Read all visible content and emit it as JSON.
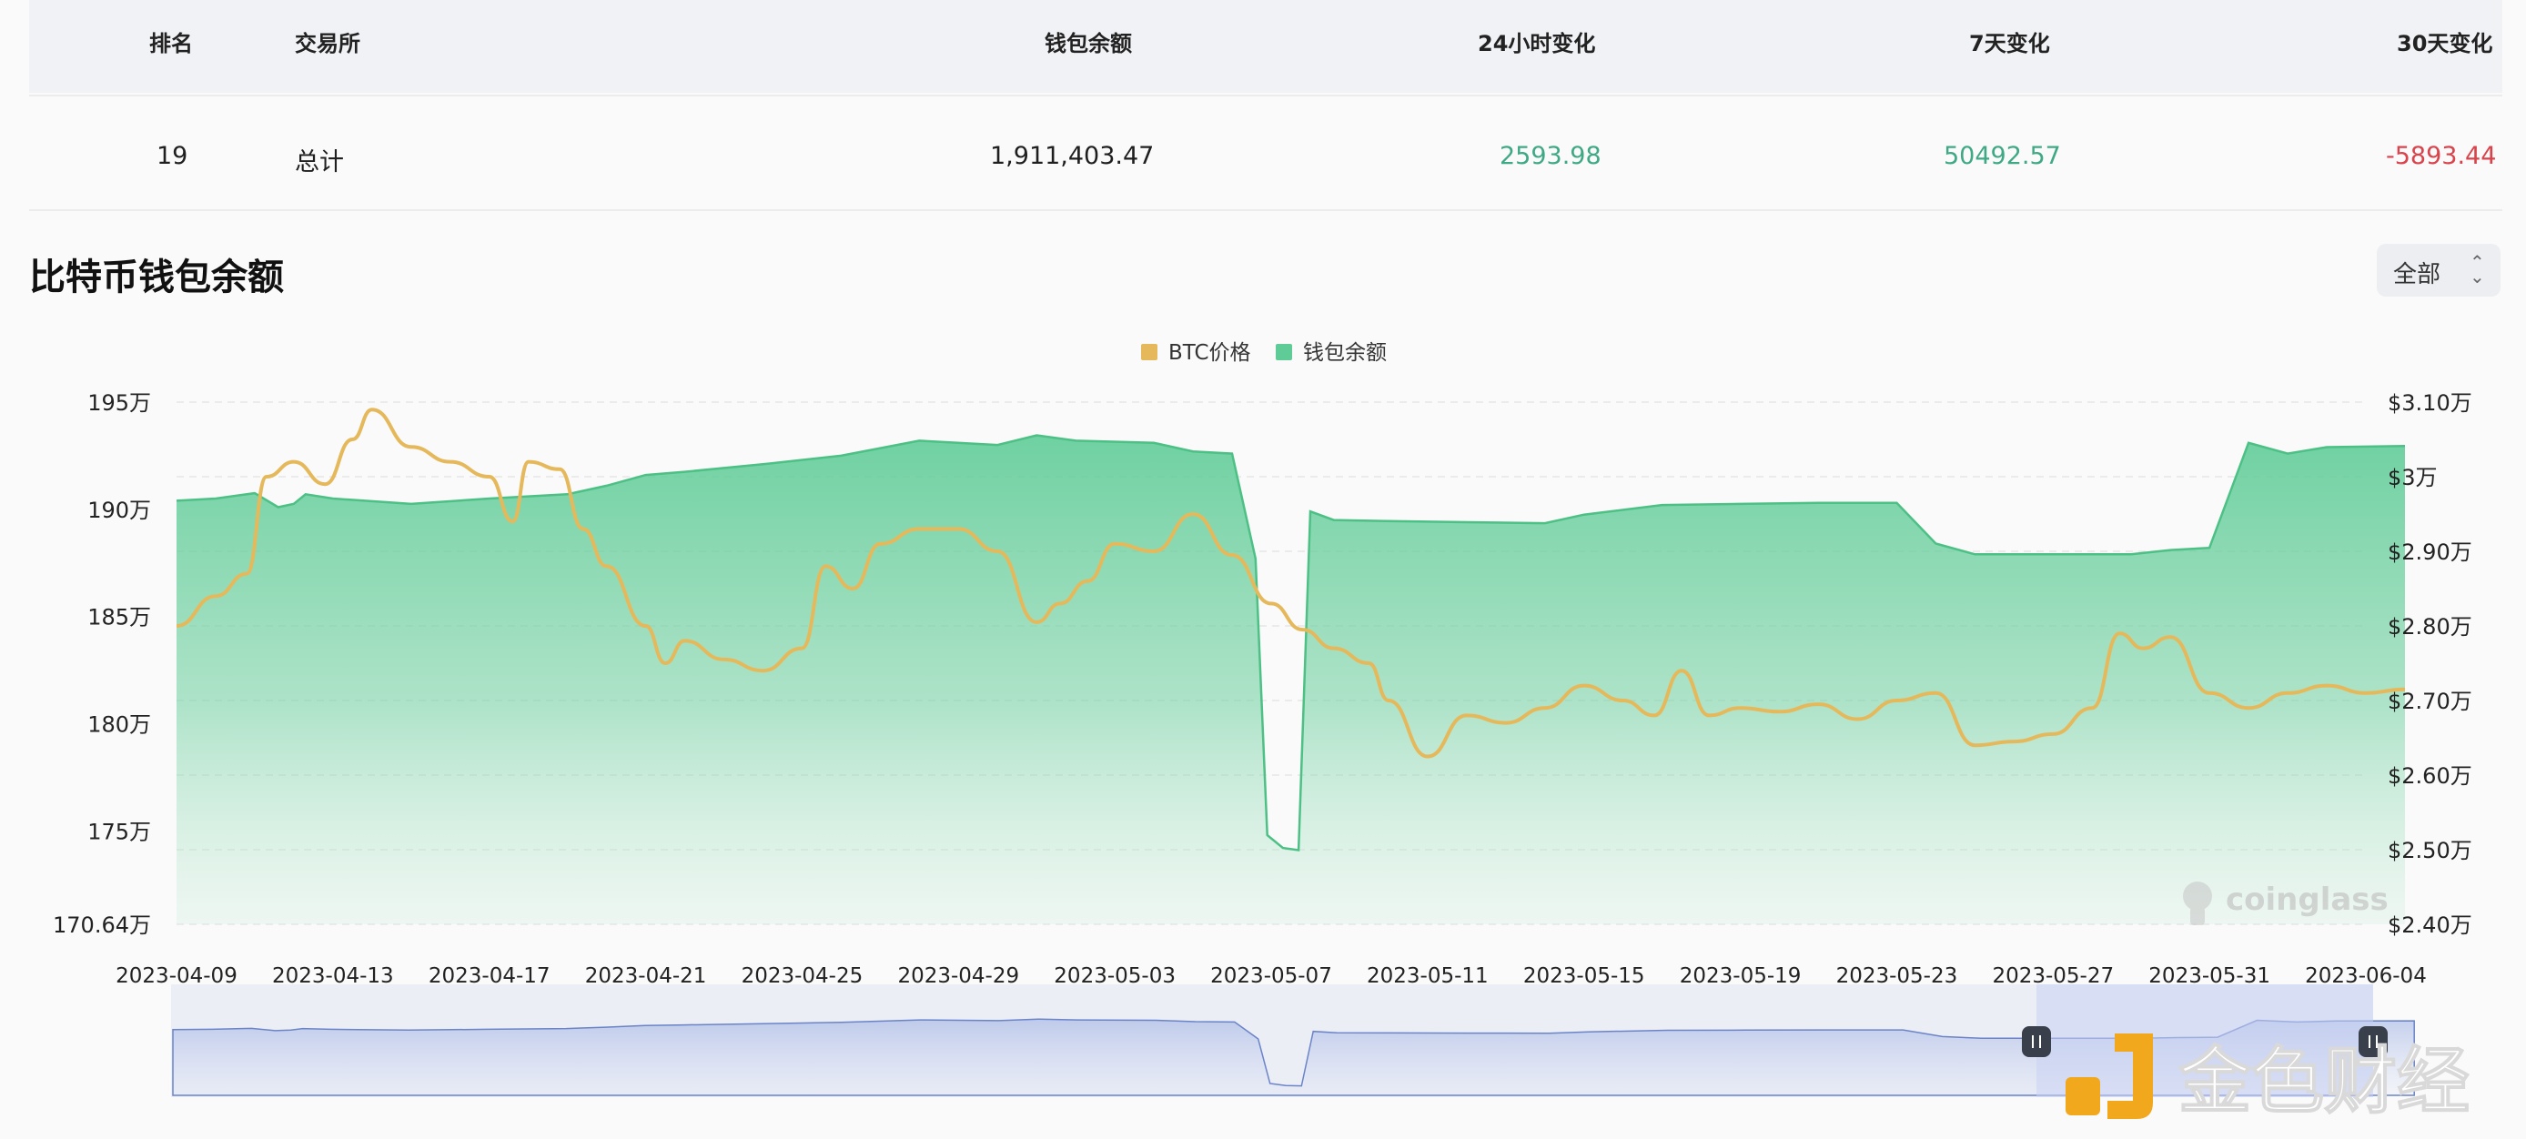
{
  "table": {
    "headers": [
      "排名",
      "交易所",
      "钱包余额",
      "24小时变化",
      "7天变化",
      "30天变化"
    ],
    "total_row": {
      "rank": "19",
      "exchange": "总计",
      "balance": "1,911,403.47",
      "change_24h": "2593.98",
      "change_7d": "50492.57",
      "change_30d": "-5893.44"
    }
  },
  "colors": {
    "positive": "#3fa884",
    "negative": "#d9434c",
    "btc_line": "#e5b95b",
    "balance_area": "#5fcc97",
    "navigator": "#4a6bb5"
  },
  "section": {
    "title": "比特币钱包余额",
    "range_select": "全部"
  },
  "watermark": "coinglass",
  "logo_text": "金色财经",
  "chart_data": {
    "type": "area",
    "legend": [
      "BTC价格",
      "钱包余额"
    ],
    "legend_position": "top-center",
    "grid": true,
    "left_axis_ticks": [
      "195万",
      "190万",
      "185万",
      "180万",
      "175万",
      "170.64万"
    ],
    "right_axis_ticks": [
      "$3.10万",
      "$3万",
      "$2.90万",
      "$2.80万",
      "$2.70万",
      "$2.60万",
      "$2.50万",
      "$2.40万"
    ],
    "x_tick_labels": [
      "2023-04-09",
      "2023-04-13",
      "2023-04-17",
      "2023-04-21",
      "2023-04-25",
      "2023-04-29",
      "2023-05-03",
      "2023-05-07",
      "2023-05-11",
      "2023-05-15",
      "2023-05-19",
      "2023-05-23",
      "2023-05-27",
      "2023-05-31",
      "2023-06-04"
    ],
    "x_start": "2023-04-09",
    "y_left_range": [
      1706400,
      1950000
    ],
    "y_right_range": [
      24000,
      31000
    ],
    "series": [
      {
        "name": "钱包余额",
        "axis": "left",
        "points": [
          [
            "2023-04-09",
            1904000
          ],
          [
            "2023-04-10",
            1905000
          ],
          [
            "2023-04-11",
            1907500
          ],
          [
            "2023-04-11.6",
            1901000
          ],
          [
            "2023-04-12",
            1902500
          ],
          [
            "2023-04-12.3",
            1907000
          ],
          [
            "2023-04-13",
            1905000
          ],
          [
            "2023-04-15",
            1902500
          ],
          [
            "2023-04-17",
            1905000
          ],
          [
            "2023-04-19",
            1907000
          ],
          [
            "2023-04-20",
            1911000
          ],
          [
            "2023-04-21",
            1916000
          ],
          [
            "2023-04-22",
            1917500
          ],
          [
            "2023-04-24",
            1921000
          ],
          [
            "2023-04-26",
            1925000
          ],
          [
            "2023-04-28",
            1932000
          ],
          [
            "2023-04-30",
            1930000
          ],
          [
            "2023-05-01",
            1934500
          ],
          [
            "2023-05-02",
            1932000
          ],
          [
            "2023-05-04",
            1931000
          ],
          [
            "2023-05-05",
            1927000
          ],
          [
            "2023-05-06",
            1926000
          ],
          [
            "2023-05-06.6",
            1877000
          ],
          [
            "2023-05-06.9",
            1748000
          ],
          [
            "2023-05-07.3",
            1742000
          ],
          [
            "2023-05-07.7",
            1741000
          ],
          [
            "2023-05-08",
            1899000
          ],
          [
            "2023-05-08.6",
            1895000
          ],
          [
            "2023-05-10",
            1894500
          ],
          [
            "2023-05-12",
            1894000
          ],
          [
            "2023-05-14",
            1893500
          ],
          [
            "2023-05-15",
            1897500
          ],
          [
            "2023-05-17",
            1902000
          ],
          [
            "2023-05-19",
            1902500
          ],
          [
            "2023-05-21",
            1903000
          ],
          [
            "2023-05-23",
            1903000
          ],
          [
            "2023-05-24",
            1884000
          ],
          [
            "2023-05-25",
            1879000
          ],
          [
            "2023-05-27",
            1879000
          ],
          [
            "2023-05-29",
            1879000
          ],
          [
            "2023-05-30",
            1881000
          ],
          [
            "2023-05-31",
            1882000
          ],
          [
            "2023-06-01",
            1931000
          ],
          [
            "2023-06-02",
            1926000
          ],
          [
            "2023-06-03",
            1929000
          ],
          [
            "2023-06-05",
            1929500
          ]
        ]
      },
      {
        "name": "BTC价格",
        "axis": "right",
        "points": [
          [
            "2023-04-09",
            28000
          ],
          [
            "2023-04-10",
            28400
          ],
          [
            "2023-04-10.8",
            28700
          ],
          [
            "2023-04-11.3",
            30000
          ],
          [
            "2023-04-12",
            30200
          ],
          [
            "2023-04-12.8",
            29900
          ],
          [
            "2023-04-13.5",
            30500
          ],
          [
            "2023-04-14",
            30900
          ],
          [
            "2023-04-15",
            30400
          ],
          [
            "2023-04-16",
            30200
          ],
          [
            "2023-04-17",
            30000
          ],
          [
            "2023-04-17.6",
            29400
          ],
          [
            "2023-04-18",
            30200
          ],
          [
            "2023-04-18.8",
            30100
          ],
          [
            "2023-04-19.4",
            29300
          ],
          [
            "2023-04-20",
            28800
          ],
          [
            "2023-04-21",
            28000
          ],
          [
            "2023-04-21.5",
            27500
          ],
          [
            "2023-04-22",
            27800
          ],
          [
            "2023-04-23",
            27550
          ],
          [
            "2023-04-24",
            27400
          ],
          [
            "2023-04-25",
            27700
          ],
          [
            "2023-04-25.6",
            28800
          ],
          [
            "2023-04-26.3",
            28500
          ],
          [
            "2023-04-27",
            29100
          ],
          [
            "2023-04-28",
            29300
          ],
          [
            "2023-04-29",
            29300
          ],
          [
            "2023-04-30",
            29000
          ],
          [
            "2023-05-01",
            28050
          ],
          [
            "2023-05-01.6",
            28300
          ],
          [
            "2023-05-02.3",
            28600
          ],
          [
            "2023-05-03",
            29100
          ],
          [
            "2023-05-04",
            29000
          ],
          [
            "2023-05-05",
            29500
          ],
          [
            "2023-05-06",
            28950
          ],
          [
            "2023-05-07",
            28300
          ],
          [
            "2023-05-07.8",
            27950
          ],
          [
            "2023-05-08.6",
            27700
          ],
          [
            "2023-05-09.5",
            27500
          ],
          [
            "2023-05-10",
            27000
          ],
          [
            "2023-05-11",
            26250
          ],
          [
            "2023-05-12",
            26800
          ],
          [
            "2023-05-13",
            26700
          ],
          [
            "2023-05-14",
            26900
          ],
          [
            "2023-05-15",
            27200
          ],
          [
            "2023-05-16",
            27000
          ],
          [
            "2023-05-16.8",
            26800
          ],
          [
            "2023-05-17.5",
            27400
          ],
          [
            "2023-05-18.2",
            26800
          ],
          [
            "2023-05-19",
            26900
          ],
          [
            "2023-05-20",
            26850
          ],
          [
            "2023-05-21",
            26950
          ],
          [
            "2023-05-22",
            26750
          ],
          [
            "2023-05-23",
            27000
          ],
          [
            "2023-05-24",
            27100
          ],
          [
            "2023-05-25",
            26400
          ],
          [
            "2023-05-26",
            26450
          ],
          [
            "2023-05-27",
            26550
          ],
          [
            "2023-05-28",
            26900
          ],
          [
            "2023-05-28.7",
            27900
          ],
          [
            "2023-05-29.3",
            27700
          ],
          [
            "2023-05-30",
            27850
          ],
          [
            "2023-05-31",
            27100
          ],
          [
            "2023-06-01",
            26900
          ],
          [
            "2023-06-02",
            27100
          ],
          [
            "2023-06-03",
            27200
          ],
          [
            "2023-06-04",
            27100
          ],
          [
            "2023-06-05",
            27150
          ]
        ]
      }
    ]
  }
}
